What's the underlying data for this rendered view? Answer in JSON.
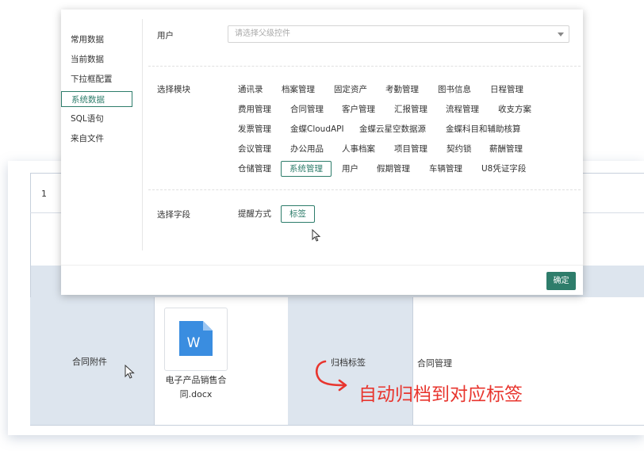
{
  "popup": {
    "sidebar": {
      "items": [
        {
          "label": "常用数据"
        },
        {
          "label": "当前数据"
        },
        {
          "label": "下拉框配置"
        },
        {
          "label": "系统数据"
        },
        {
          "label": "SQL语句"
        },
        {
          "label": "来自文件"
        }
      ],
      "active_index": 3
    },
    "user_field": {
      "label": "用户",
      "placeholder": "请选择父级控件"
    },
    "module_field": {
      "label": "选择模块",
      "rows": [
        [
          "通讯录",
          "档案管理",
          "固定资产",
          "考勤管理",
          "图书信息",
          "日程管理"
        ],
        [
          "费用管理",
          "合同管理",
          "客户管理",
          "汇报管理",
          "流程管理",
          "收支方案"
        ],
        [
          "发票管理",
          "金蝶CloudAPI",
          "金蝶云星空数据源",
          "金蝶科目和辅助核算"
        ],
        [
          "会议管理",
          "办公用品",
          "人事档案",
          "项目管理",
          "契约锁",
          "薪酬管理"
        ],
        [
          "仓储管理",
          "系统管理",
          "用户",
          "假期管理",
          "车辆管理",
          "U8凭证字段"
        ]
      ],
      "selected": "系统管理"
    },
    "field_select": {
      "label": "选择字段",
      "options": [
        "提醒方式",
        "标签"
      ],
      "selected": "标签"
    },
    "confirm_label": "确定"
  },
  "form": {
    "row_number": "1",
    "attachment_label": "合同附件",
    "file": {
      "name_line1": "电子产品销售合",
      "name_line2": "同.docx",
      "icon_letter": "W"
    },
    "archive_label": "归档标签",
    "archive_value": "合同管理"
  },
  "annotation": {
    "text": "自动归档到对应标签",
    "color": "#e8352e"
  },
  "colors": {
    "accent": "#2e7d6b",
    "word_blue": "#3a8de0",
    "cell_bg": "#dde5ee"
  }
}
